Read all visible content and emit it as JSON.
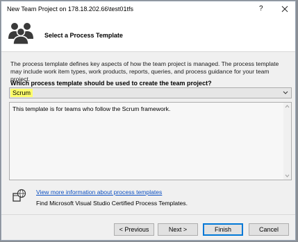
{
  "window": {
    "title": "New Team Project on 178.18.202.66\\test01tfs",
    "help_label": "?"
  },
  "header": {
    "title": "Select a Process Template"
  },
  "description": "The process template defines key aspects of how the team project is managed. The process template may include work item types, work products, reports, queries, and process guidance for your team project.",
  "question": "Which process template should be used to create the team project?",
  "template_select": {
    "selected": "Scrum"
  },
  "template_description": "This template is for teams who follow the Scrum framework.",
  "links": {
    "more_info": "View more information about process templates",
    "certified": "Find Microsoft Visual Studio Certified Process Templates."
  },
  "buttons": {
    "previous": "< Previous",
    "next": "Next >",
    "finish": "Finish",
    "cancel": "Cancel"
  },
  "colors": {
    "highlight": "#ffff6b",
    "link": "#0b4fc2",
    "focus": "#0078d7"
  }
}
